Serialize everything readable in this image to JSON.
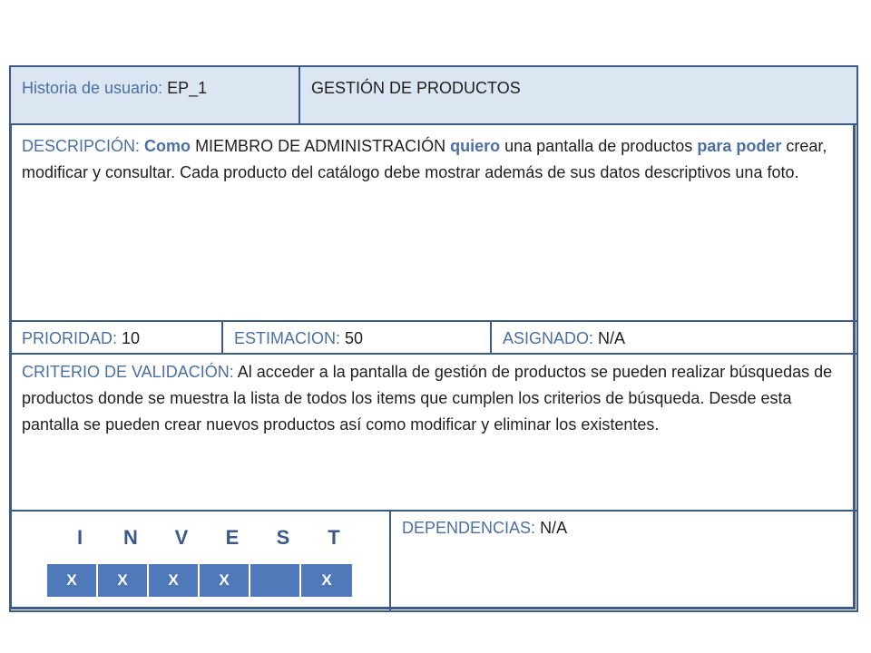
{
  "header": {
    "story_label": "Historia de usuario:",
    "story_id": "EP_1",
    "story_title": "GESTIÓN DE PRODUCTOS"
  },
  "description": {
    "label": "DESCRIPCIÓN:",
    "kw_como": "Como",
    "role": "MIEMBRO DE ADMINISTRACIÓN",
    "kw_quiero": "quiero",
    "want": "una pantalla de productos",
    "kw_para": "para",
    "kw_poder": "poder",
    "rest": "crear, modificar y consultar. Cada producto del catálogo debe mostrar además de sus datos descriptivos una foto."
  },
  "meta": {
    "priority_label": "PRIORIDAD:",
    "priority_value": "10",
    "estimation_label": "ESTIMACION:",
    "estimation_value": "50",
    "assigned_label": "ASIGNADO:",
    "assigned_value": "N/A"
  },
  "criteria": {
    "label": "CRITERIO DE VALIDACIÓN:",
    "text": "Al acceder a la pantalla de gestión de productos se pueden realizar búsquedas de productos donde se muestra la lista de todos los items que cumplen los criterios de búsqueda. Desde esta pantalla se pueden crear nuevos productos así como modificar y eliminar los existentes."
  },
  "invest": {
    "letters": [
      "I",
      "N",
      "V",
      "E",
      "S",
      "T"
    ],
    "marks": [
      "X",
      "X",
      "X",
      "X",
      "",
      "X"
    ]
  },
  "dependencies": {
    "label": "DEPENDENCIAS:",
    "value": "N/A"
  }
}
